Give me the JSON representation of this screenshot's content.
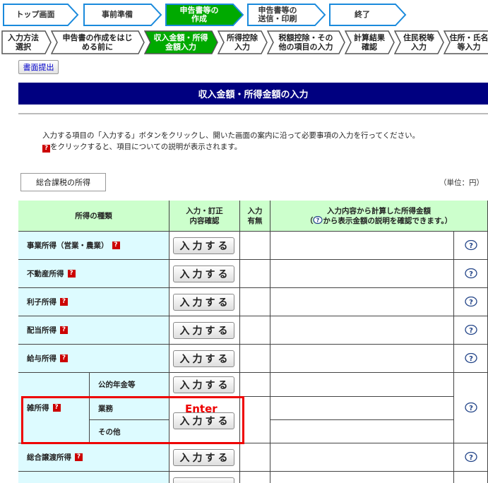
{
  "steps": [
    {
      "label": "トップ画面",
      "active": false
    },
    {
      "label": "事前準備",
      "active": false
    },
    {
      "label": "申告書等の\n作成",
      "active": true
    },
    {
      "label": "申告書等の\n送信・印刷",
      "active": false
    },
    {
      "label": "終了",
      "active": false
    }
  ],
  "subtabs": [
    {
      "label": "入力方法\n選択",
      "active": false
    },
    {
      "label": "申告書の作成をはじ\nめる前に",
      "active": false
    },
    {
      "label": "収入金額・所得\n金額入力",
      "active": true
    },
    {
      "label": "所得控除\n入力",
      "active": false
    },
    {
      "label": "税額控除・その\n他の項目の入力",
      "active": false
    },
    {
      "label": "計算結果\n確認",
      "active": false
    },
    {
      "label": "住民税等\n入力",
      "active": false
    },
    {
      "label": "住所・氏名\n等入力",
      "active": false
    }
  ],
  "submit_button": "書面提出",
  "page_title": "収入金額・所得金額の入力",
  "instructions": {
    "line1": "入力する項目の「入力する」ボタンをクリックし、開いた画面の案内に沿って必要事項の入力を行ってください。",
    "line2_icon": "?",
    "line2": "をクリックすると、項目についての説明が表示されます。"
  },
  "section_button": "総合課税の所得",
  "unit": "（単位：円）",
  "table": {
    "headers": {
      "kind": "所得の種類",
      "action": "入力・訂正\n内容確認",
      "status": "入力\n有無",
      "amount_line1": "入力内容から計算した所得金額",
      "amount_line2_pre": "（",
      "amount_line2_post": "から表示金額の説明を確認できます。）"
    },
    "input_label": "入力する",
    "rows": [
      {
        "name": "事業所得（営業・農業）"
      },
      {
        "name": "不動産所得"
      },
      {
        "name": "利子所得"
      },
      {
        "name": "配当所得"
      },
      {
        "name": "給与所得"
      },
      {
        "name": "総合譲渡所得"
      }
    ],
    "misc": {
      "name": "雑所得",
      "sub": [
        "公的年金等",
        "業務",
        "その他"
      ]
    }
  },
  "annotation": {
    "label": "Enter",
    "color": "#ee0000"
  },
  "colors": {
    "title_bar": "#000080",
    "header": "#ccffcc",
    "row_name": "#ddfbff",
    "active_step": "#00aa00",
    "inactive_step_border": "#1a8adc"
  }
}
